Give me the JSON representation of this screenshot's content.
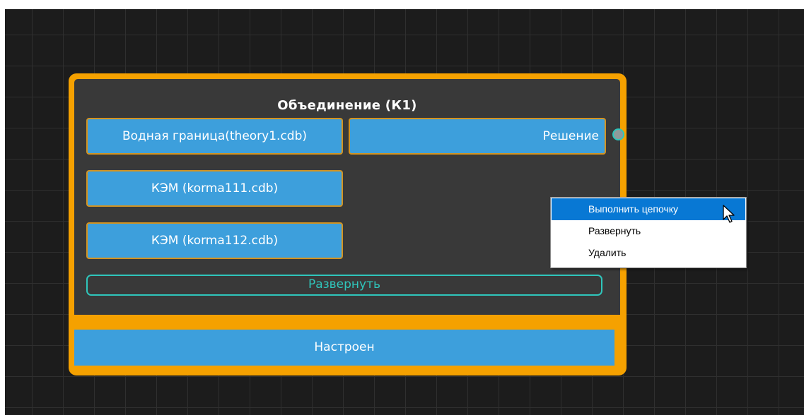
{
  "node": {
    "title": "Объединение (К1)",
    "inputs": [
      {
        "label": "Водная граница(theory1.cdb)"
      },
      {
        "label": "КЭМ (korma111.cdb)"
      },
      {
        "label": "КЭМ (korma112.cdb)"
      }
    ],
    "output": {
      "label": "Решение"
    },
    "expand_label": "Развернуть",
    "status": "Настроен"
  },
  "context_menu": {
    "items": [
      {
        "label": "Выполнить цепочку",
        "highlighted": true
      },
      {
        "label": "Развернуть",
        "highlighted": false
      },
      {
        "label": "Удалить",
        "highlighted": false
      }
    ]
  },
  "colors": {
    "canvas": "#1c1c1c",
    "grid_line": "#2f2f2f",
    "node_frame": "#f5a100",
    "node_body": "#393939",
    "port_blue": "#3d9fdc",
    "accent_teal": "#2fc6bc",
    "menu_highlight": "#0878d4"
  }
}
